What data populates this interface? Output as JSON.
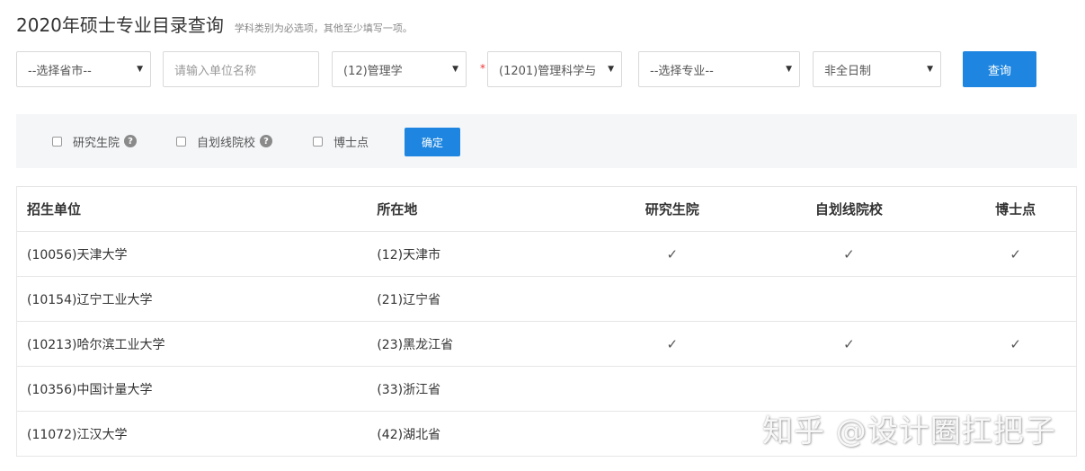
{
  "header": {
    "title": "2020年硕士专业目录查询",
    "hint": "学科类别为必选项，其他至少填写一项。"
  },
  "filters": {
    "province": "--选择省市--",
    "unit_placeholder": "请输入单位名称",
    "discipline": "(12)管理学",
    "required_mark": "*",
    "subject": "(1201)管理科学与",
    "major": "--选择专业--",
    "study_mode": "非全日制",
    "query_label": "查询",
    "caret": "▼"
  },
  "options": {
    "items": [
      {
        "label": "研究生院",
        "help": "?"
      },
      {
        "label": "自划线院校",
        "help": "?"
      },
      {
        "label": "博士点"
      }
    ],
    "confirm_label": "确定"
  },
  "table": {
    "columns": [
      "招生单位",
      "所在地",
      "研究生院",
      "自划线院校",
      "博士点"
    ],
    "check_glyph": "✓",
    "rows": [
      {
        "unit": "(10056)天津大学",
        "location": "(12)天津市",
        "grad": true,
        "self": true,
        "phd": true
      },
      {
        "unit": "(10154)辽宁工业大学",
        "location": "(21)辽宁省",
        "grad": false,
        "self": false,
        "phd": false
      },
      {
        "unit": "(10213)哈尔滨工业大学",
        "location": "(23)黑龙江省",
        "grad": true,
        "self": true,
        "phd": true
      },
      {
        "unit": "(10356)中国计量大学",
        "location": "(33)浙江省",
        "grad": false,
        "self": false,
        "phd": false
      },
      {
        "unit": "(11072)江汉大学",
        "location": "(42)湖北省",
        "grad": false,
        "self": false,
        "phd": false
      }
    ]
  },
  "watermark": "知乎 @设计圈扛把子"
}
